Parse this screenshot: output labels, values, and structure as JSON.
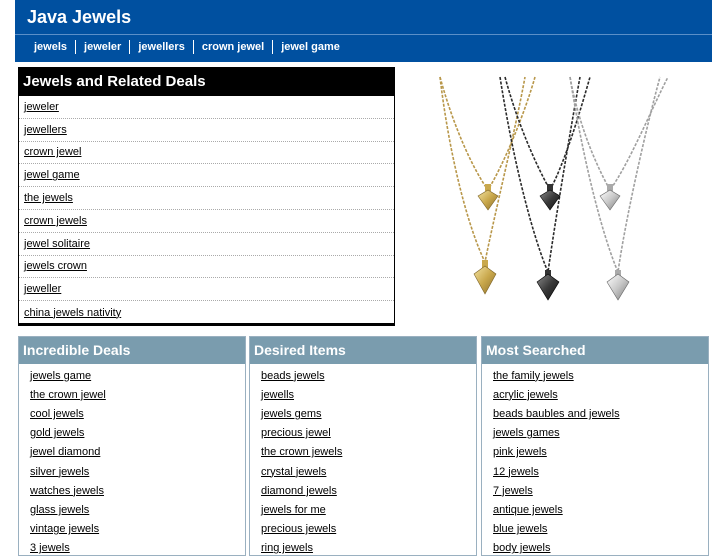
{
  "site": {
    "title": "Java Jewels"
  },
  "nav": [
    "jewels",
    "jeweler",
    "jewellers",
    "crown jewel",
    "jewel game"
  ],
  "deals": {
    "title": "Jewels and Related Deals",
    "items": [
      "jeweler",
      "jewellers",
      "crown jewel",
      "jewel game",
      "the jewels",
      "crown jewels",
      "jewel solitaire",
      "jewels crown",
      "jeweller",
      "china jewels nativity"
    ]
  },
  "columns": [
    {
      "title": "Incredible Deals",
      "items": [
        "jewels game",
        "the crown jewel",
        "cool jewels",
        "gold jewels",
        "jewel diamond",
        "silver jewels",
        "watches jewels",
        "glass jewels",
        "vintage jewels",
        "3 jewels"
      ]
    },
    {
      "title": "Desired Items",
      "items": [
        "beads jewels",
        "jewells",
        "jewels gems",
        "precious jewel",
        "the crown jewels",
        "crystal jewels",
        "diamond jewels",
        "jewels for me",
        "precious jewels",
        "ring jewels"
      ]
    },
    {
      "title": "Most Searched",
      "items": [
        "the family jewels",
        "acrylic jewels",
        "beads baubles and jewels",
        "jewels games",
        "pink jewels",
        "12 jewels",
        "7 jewels",
        "antique jewels",
        "blue jewels",
        "body jewels"
      ]
    }
  ],
  "colors": {
    "header": "#0050a0",
    "deals_header": "#000000",
    "column_header": "#7a9cae"
  },
  "image": {
    "semantic": "necklace-pendants-photo"
  }
}
